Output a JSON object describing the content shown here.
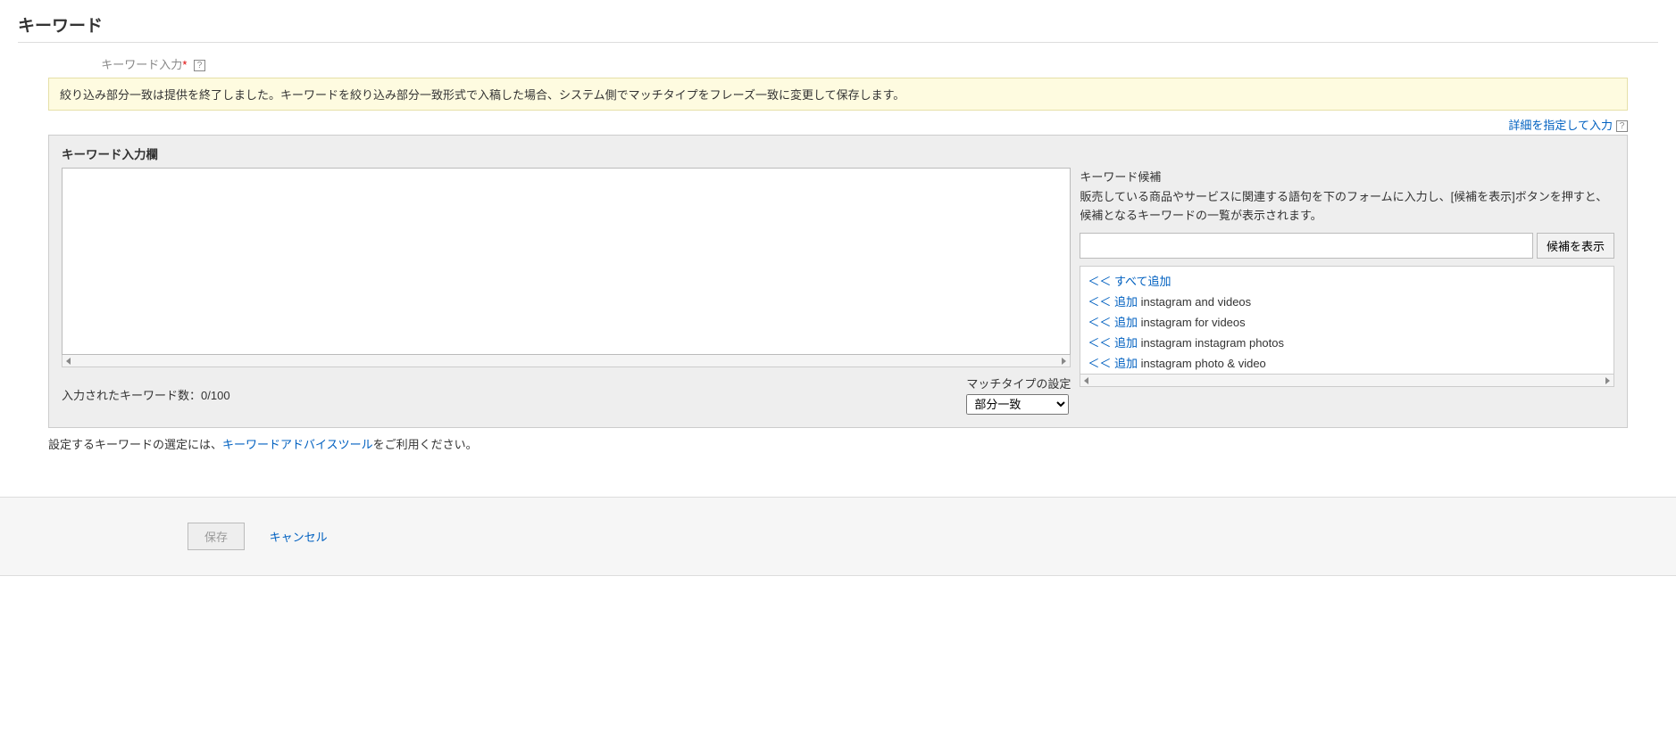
{
  "page": {
    "title": "キーワード",
    "input_label": "キーワード入力",
    "required_mark": "*"
  },
  "notice": "絞り込み部分一致は提供を終了しました。キーワードを絞り込み部分一致形式で入稿した場合、システム側でマッチタイプをフレーズ一致に変更して保存します。",
  "detail_link": "詳細を指定して入力",
  "editor": {
    "title": "キーワード入力欄",
    "count_label_prefix": "入力されたキーワード数：",
    "count_value": "0/100",
    "match_label": "マッチタイプの設定",
    "match_selected": "部分一致"
  },
  "candidate": {
    "title": "キーワード候補",
    "desc": "販売している商品やサービスに関連する語句を下のフォームに入力し、[候補を表示]ボタンを押すと、候補となるキーワードの一覧が表示されます。",
    "button": "候補を表示",
    "add_all_prefix": "＜＜ ",
    "add_all": "すべて追加",
    "add_prefix": "＜＜ ",
    "add_word": "追加",
    "items": [
      "instagram and videos",
      "instagram for videos",
      "instagram instagram photos",
      "instagram photo & video"
    ]
  },
  "tool_hint": {
    "before": "設定するキーワードの選定には、",
    "link": "キーワードアドバイスツール",
    "after": "をご利用ください。"
  },
  "footer": {
    "save": "保存",
    "cancel": "キャンセル"
  }
}
